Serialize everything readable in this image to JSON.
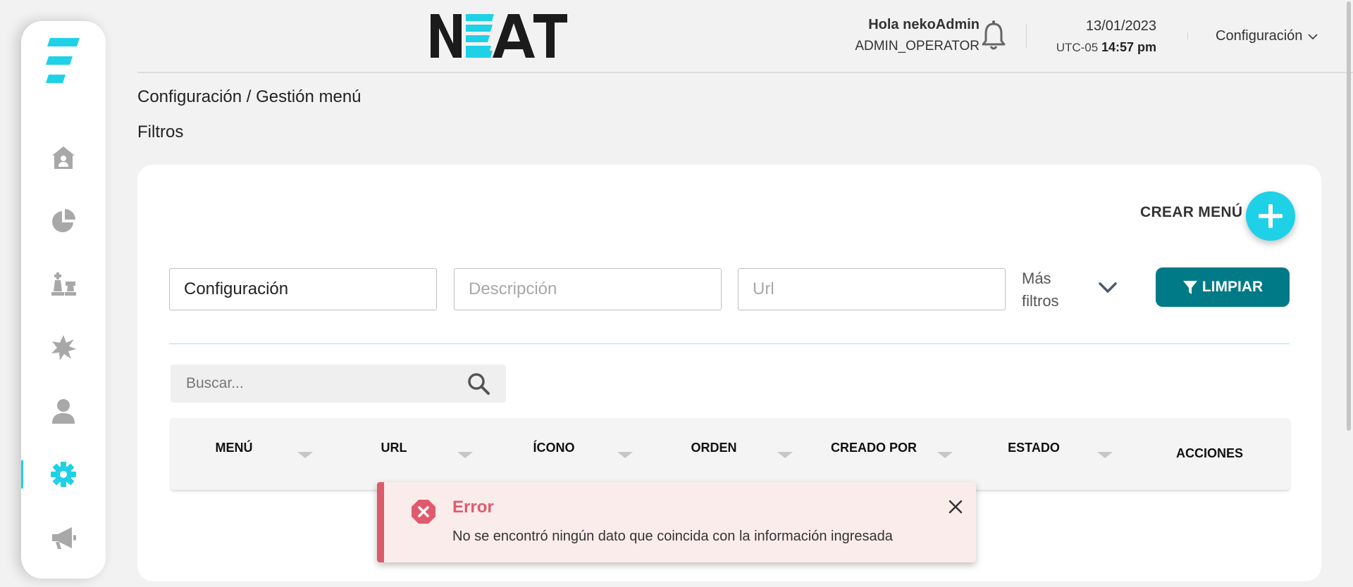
{
  "brand": {
    "name": "NEAT",
    "accent": "#1fd1e6",
    "dark": "#1b1b1b"
  },
  "header": {
    "greeting": "Hola nekoAdmin",
    "role": "ADMIN_OPERATOR",
    "date": "13/01/2023",
    "tz": "UTC-05",
    "time": "14:57 pm",
    "config_menu": "Configuración"
  },
  "sidebar": {
    "items": [
      {
        "name": "home-icon"
      },
      {
        "name": "pie-chart-icon"
      },
      {
        "name": "chess-pieces-icon"
      },
      {
        "name": "starburst-icon"
      },
      {
        "name": "user-icon"
      },
      {
        "name": "gear-icon",
        "active": true
      },
      {
        "name": "megaphone-icon"
      }
    ]
  },
  "page": {
    "breadcrumb": "Configuración / Gestión menú",
    "filters_title": "Filtros"
  },
  "actions": {
    "create_menu": "CREAR MENÚ",
    "more_filters_line1": "Más",
    "more_filters_line2": "filtros",
    "clear": "LIMPIAR"
  },
  "filters": {
    "menu_value": "Configuración",
    "description_placeholder": "Descripción",
    "url_placeholder": "Url"
  },
  "search": {
    "placeholder": "Buscar..."
  },
  "table": {
    "columns": [
      "MENÚ",
      "URL",
      "ÍCONO",
      "ORDEN",
      "CREADO POR",
      "ESTADO",
      "ACCIONES"
    ]
  },
  "toast": {
    "title": "Error",
    "message": "No se encontró ningún dato que coincida con la información ingresada",
    "color": "#db5b6b"
  },
  "colors": {
    "primary_button": "#007a87",
    "fab": "#1fd1e6"
  }
}
